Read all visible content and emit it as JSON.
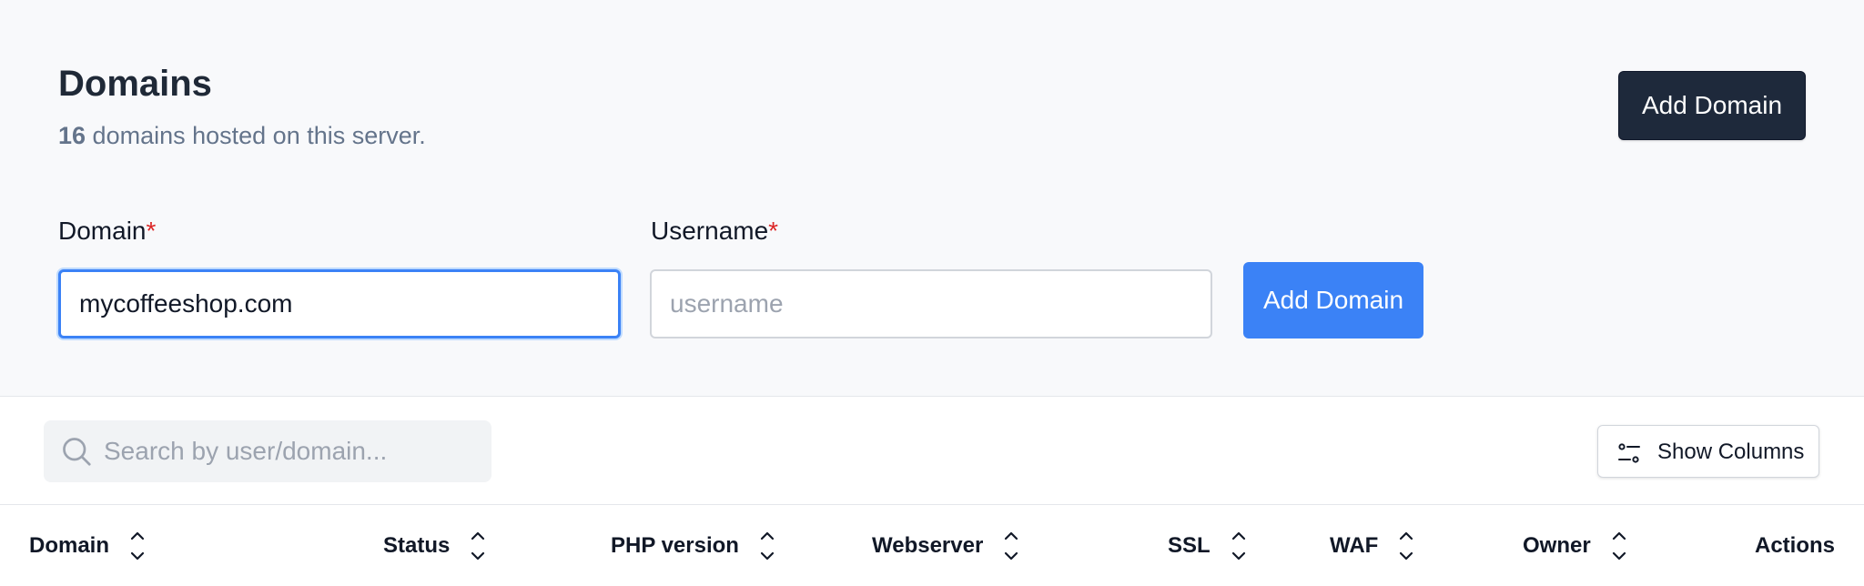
{
  "header": {
    "title": "Domains",
    "count": "16",
    "subtitle_text": " domains hosted on this server.",
    "add_button_label": "Add Domain"
  },
  "form": {
    "domain_label": "Domain",
    "username_label": "Username",
    "required_marker": "*",
    "domain_value": "mycoffeeshop.com",
    "username_placeholder": "username",
    "submit_label": "Add Domain"
  },
  "toolbar": {
    "search_placeholder": "Search by user/domain...",
    "show_columns_label": "Show Columns"
  },
  "table": {
    "columns": [
      {
        "label": "Domain",
        "sortable": true
      },
      {
        "label": "Status",
        "sortable": true
      },
      {
        "label": "PHP version",
        "sortable": true
      },
      {
        "label": "Webserver",
        "sortable": true
      },
      {
        "label": "SSL",
        "sortable": true
      },
      {
        "label": "WAF",
        "sortable": true
      },
      {
        "label": "Owner",
        "sortable": true
      },
      {
        "label": "Actions",
        "sortable": false
      }
    ]
  },
  "colors": {
    "primary_dark": "#1e293b",
    "primary_blue": "#3b82f6",
    "required_red": "#dc2626",
    "muted_text": "#64748b"
  },
  "icons": {
    "search": "search-icon",
    "columns": "adjustments-icon",
    "sort": "sort-chevrons-icon"
  }
}
